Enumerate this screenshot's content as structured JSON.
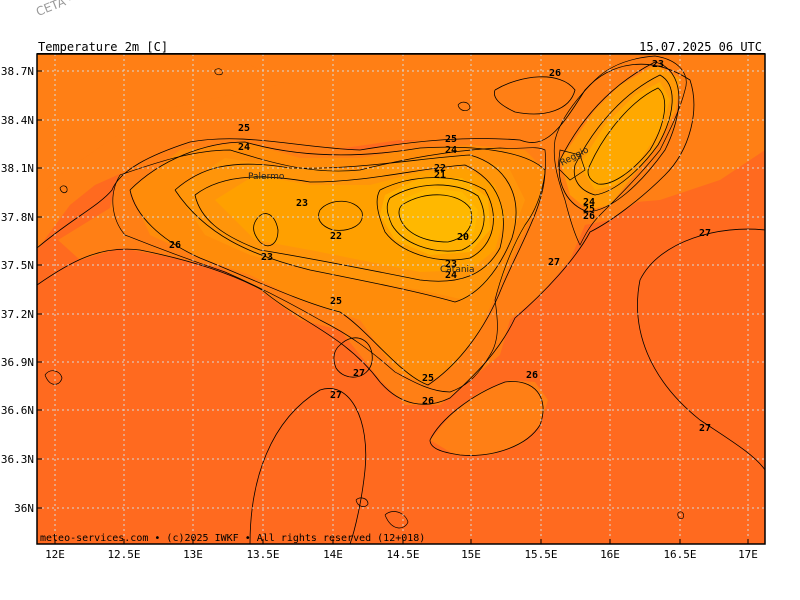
{
  "watermark": "CETA - Ins",
  "header": {
    "variable": "Temperature_2m_[C]",
    "valid_time": "15.07.2025 06 UTC"
  },
  "footer": "meteo-services.com • (c)2025 IWKF • All rights reserved (12+018)",
  "axes": {
    "lat_labels": [
      "38.7N",
      "38.4N",
      "38.1N",
      "37.8N",
      "37.5N",
      "37.2N",
      "36.9N",
      "36.6N",
      "36.3N",
      "36N"
    ],
    "lon_labels": [
      "12E",
      "12.5E",
      "13E",
      "13.5E",
      "14E",
      "14.5E",
      "15E",
      "15.5E",
      "16E",
      "16.5E",
      "17E"
    ]
  },
  "cities": [
    "Palermo",
    "Catania",
    "Reggio"
  ],
  "contour_labels": [
    "26",
    "23",
    "25",
    "24",
    "25",
    "24",
    "22",
    "21",
    "23",
    "22",
    "20",
    "23",
    "24",
    "26",
    "23",
    "27",
    "25",
    "27",
    "27",
    "25",
    "26",
    "26",
    "24",
    "25",
    "26",
    "27",
    "27"
  ],
  "colors": {
    "sea_warm": "#FF6A1F",
    "coast_band": "#FF7F15",
    "land_warm": "#FF8C0A",
    "interior": "#FFA000",
    "hot_core": "#FFB300",
    "contour": "#000000",
    "grid": "#d8d8d8"
  }
}
